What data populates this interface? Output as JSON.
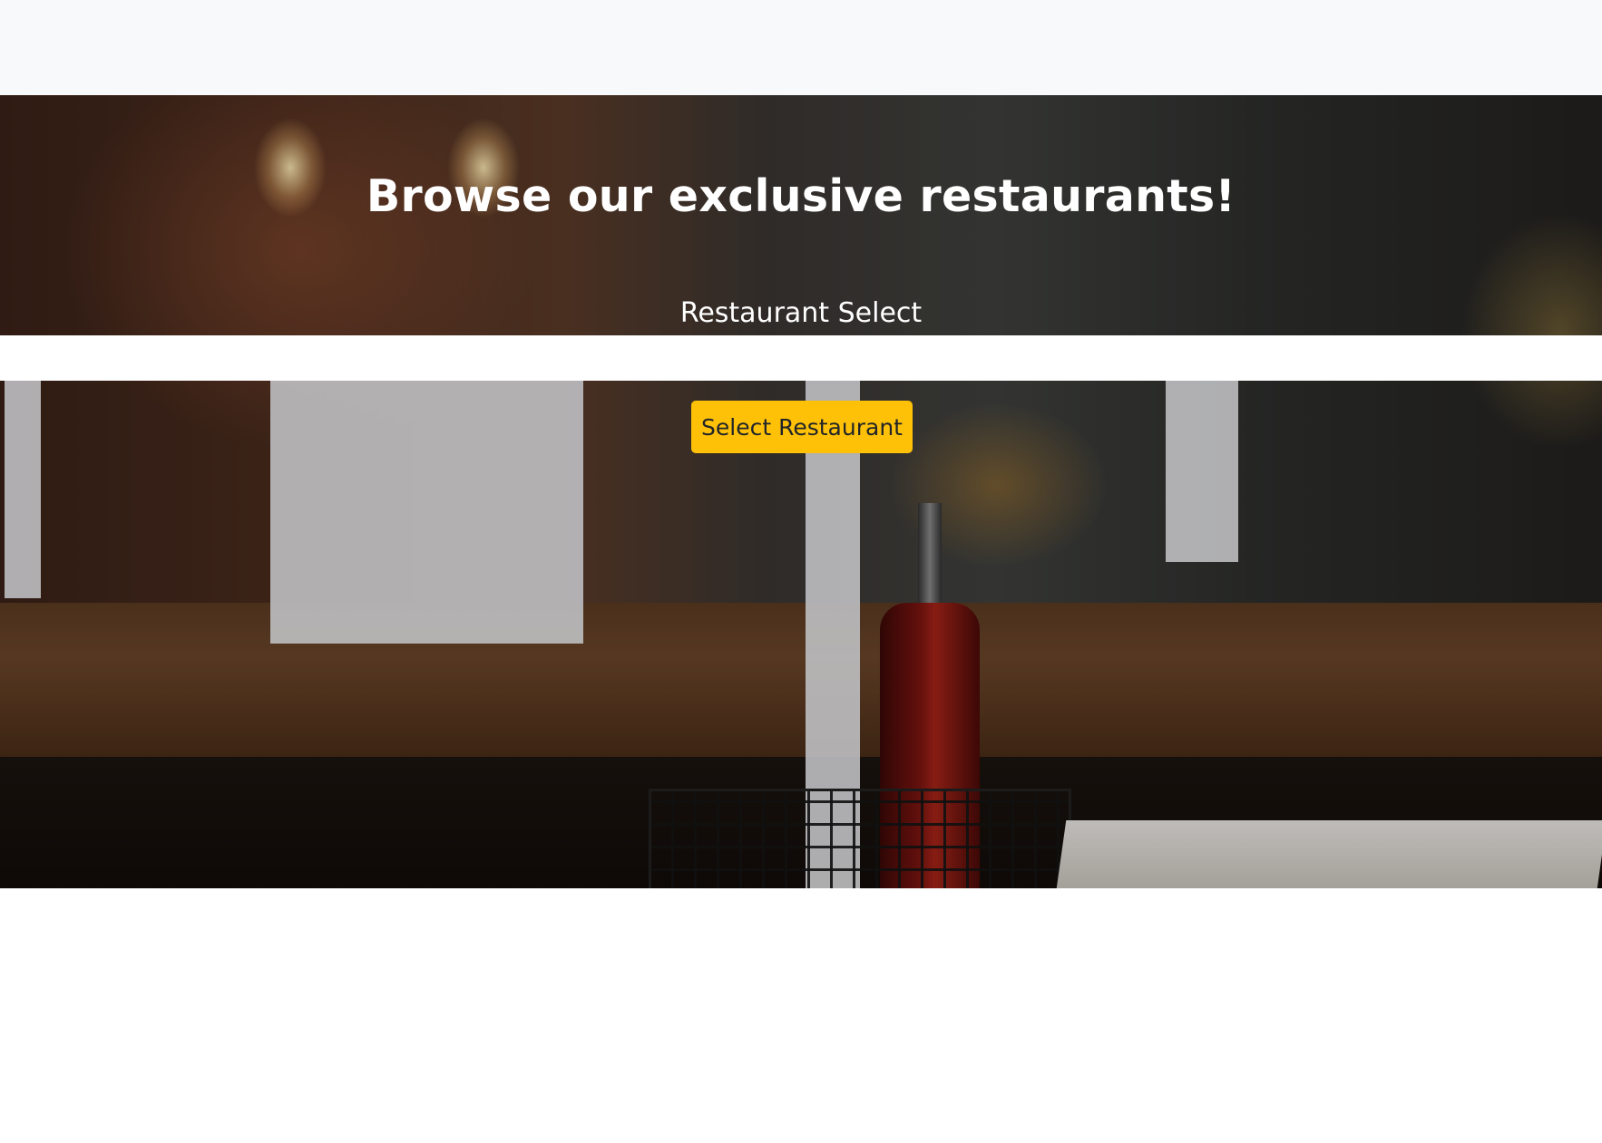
{
  "hero": {
    "headline": "Browse our exclusive restaurants!",
    "select_label": "Restaurant Select",
    "button_label": "Select Restaurant"
  },
  "colors": {
    "navbar_bg": "#f8f9fa",
    "button_bg": "#ffc107",
    "button_text": "#212529",
    "hero_text": "#ffffff"
  }
}
